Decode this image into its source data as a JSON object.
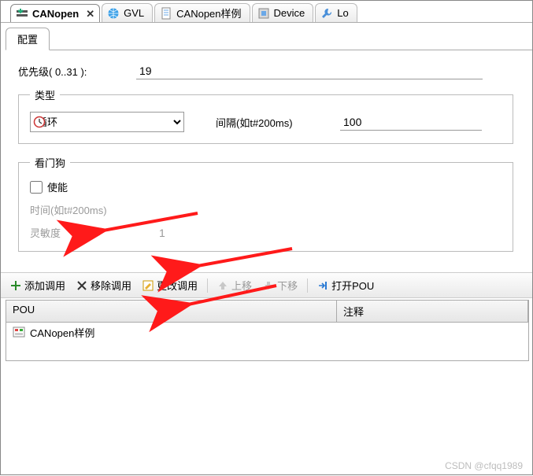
{
  "tabs": [
    {
      "label": "CANopen",
      "active": true,
      "closeable": true
    },
    {
      "label": "GVL"
    },
    {
      "label": "CANopen样例"
    },
    {
      "label": "Device"
    },
    {
      "label": "Lo"
    }
  ],
  "subtab": {
    "label": "配置"
  },
  "form": {
    "priority_label": "优先级( 0..31 ):",
    "priority_value": "19"
  },
  "type_group": {
    "legend": "类型",
    "type_value": "循环",
    "interval_label": "间隔(如t#200ms)",
    "interval_value": "100"
  },
  "watchdog_group": {
    "legend": "看门狗",
    "enable_label": "使能",
    "enable_checked": false,
    "time_label": "时间(如t#200ms)",
    "time_value": "",
    "sensitivity_label": "灵敏度",
    "sensitivity_value": "1"
  },
  "toolbar": {
    "add_call": "添加调用",
    "remove_call": "移除调用",
    "change_call": "更改调用",
    "move_up": "上移",
    "move_down": "下移",
    "open_pou": "打开POU"
  },
  "grid": {
    "col1_header": "POU",
    "col2_header": "注释",
    "rows": [
      {
        "pou": "CANopen样例",
        "comment": ""
      }
    ]
  },
  "watermark": "CSDN @cfqq1989"
}
